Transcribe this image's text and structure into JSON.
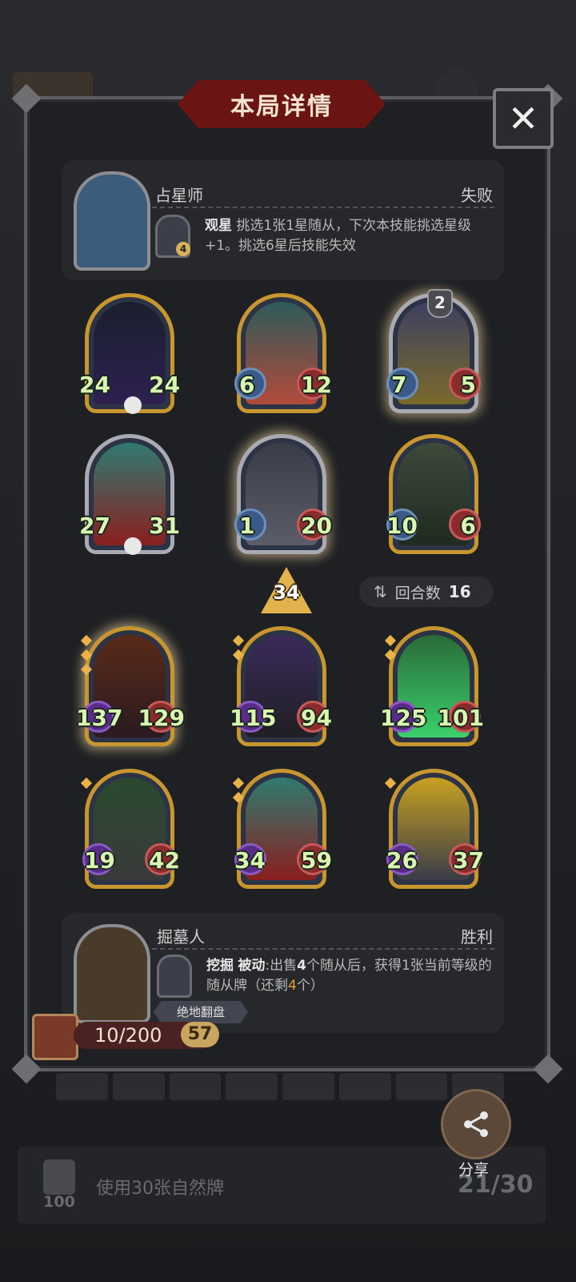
{
  "title": "本局详情",
  "opponent": {
    "name": "占星师",
    "result": "失败",
    "skill_name": "观星",
    "skill_desc": "挑选1张1星随从，下次本技能挑选星级+1。挑选6星后技能失效",
    "skill_cost": "4"
  },
  "opponent_cards": [
    {
      "atk": "24",
      "hp": "24"
    },
    {
      "atk": "6",
      "hp": "12"
    },
    {
      "atk": "7",
      "hp": "5",
      "star": "2"
    },
    {
      "atk": "27",
      "hp": "31"
    },
    {
      "atk": "1",
      "hp": "20"
    },
    {
      "atk": "10",
      "hp": "6"
    }
  ],
  "level": "34",
  "turns": {
    "label": "回合数",
    "value": "16"
  },
  "player_cards": [
    {
      "atk": "137",
      "hp": "129"
    },
    {
      "atk": "115",
      "hp": "94"
    },
    {
      "atk": "125",
      "hp": "101"
    },
    {
      "atk": "19",
      "hp": "42"
    },
    {
      "atk": "34",
      "hp": "59"
    },
    {
      "atk": "26",
      "hp": "37"
    }
  ],
  "player": {
    "name": "掘墓人",
    "result": "胜利",
    "skill_name": "挖掘",
    "skill_type": "被动",
    "skill_desc_1": ":出售",
    "skill_desc_num1": "4",
    "skill_desc_2": "个随从后，获得1张当前等级的随从牌（还剩",
    "skill_desc_num2": "4",
    "skill_desc_3": "个）",
    "tag": "绝地翻盘",
    "rank": "10/200",
    "rank_badge": "57"
  },
  "share_label": "分享",
  "quest": {
    "text": "使用30张自然牌",
    "progress": "21/30",
    "reward": "100"
  },
  "colors": {
    "gold_frame": "#c8962f",
    "stat_green": "#d9f5b0",
    "title_red": "#6a1414"
  }
}
